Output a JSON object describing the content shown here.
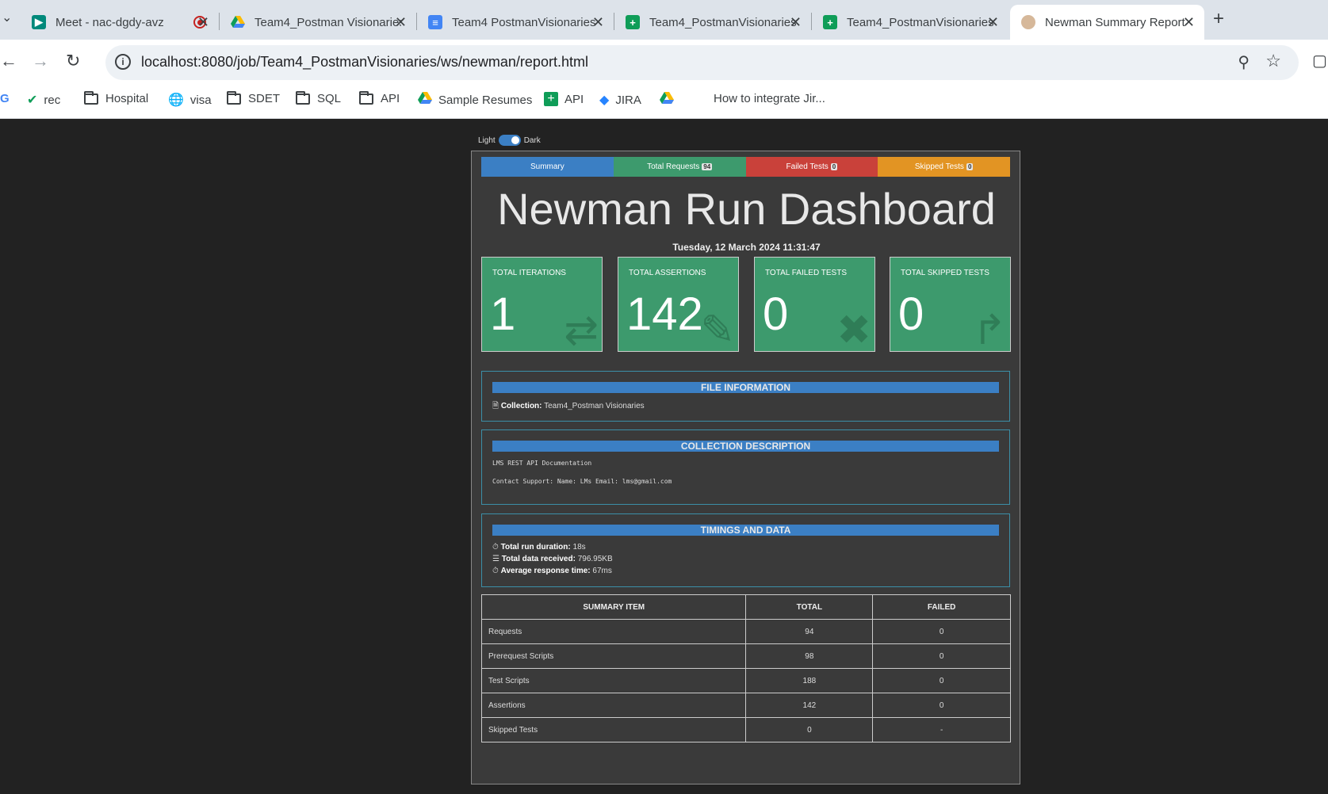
{
  "browser": {
    "tabs": [
      {
        "title": "Meet - nac-dgdy-avz",
        "icon": "google-meet-icon"
      },
      {
        "title": "Team4_Postman Visionaries",
        "icon": "google-drive-icon"
      },
      {
        "title": "Team4 PostmanVisionaries",
        "icon": "google-docs-icon"
      },
      {
        "title": "Team4_PostmanVisionaries",
        "icon": "google-sheets-icon"
      },
      {
        "title": "Team4_PostmanVisionaries",
        "icon": "google-sheets-icon"
      },
      {
        "title": "Newman Summary Report",
        "icon": "jenkins-icon"
      }
    ],
    "url": "localhost:8080/job/Team4_PostmanVisionaries/ws/newman/report.html",
    "bookmarks": [
      {
        "label": "G"
      },
      {
        "label": "rec"
      },
      {
        "label": "Hospital"
      },
      {
        "label": "visa"
      },
      {
        "label": "SDET"
      },
      {
        "label": "SQL"
      },
      {
        "label": "API"
      },
      {
        "label": "Sample Resumes"
      },
      {
        "label": "API"
      },
      {
        "label": "JIRA"
      },
      {
        "label": "How to integrate Jir..."
      }
    ]
  },
  "theme": {
    "light": "Light",
    "dark": "Dark"
  },
  "nav": {
    "summary": "Summary",
    "total_requests": "Total Requests",
    "total_requests_count": "94",
    "failed_tests": "Failed Tests",
    "failed_tests_count": "0",
    "skipped_tests": "Skipped Tests",
    "skipped_tests_count": "0"
  },
  "dashboard": {
    "title": "Newman Run Dashboard",
    "date": "Tuesday, 12 March 2024 11:31:47"
  },
  "cards": [
    {
      "label": "TOTAL ITERATIONS",
      "value": "1"
    },
    {
      "label": "TOTAL ASSERTIONS",
      "value": "142"
    },
    {
      "label": "TOTAL FAILED TESTS",
      "value": "0"
    },
    {
      "label": "TOTAL SKIPPED TESTS",
      "value": "0"
    }
  ],
  "file_info": {
    "heading": "FILE INFORMATION",
    "collection_label": "Collection:",
    "collection_value": "Team4_Postman Visionaries"
  },
  "collection_description": {
    "heading": "COLLECTION DESCRIPTION",
    "line1": "LMS REST API Documentation",
    "line2": "Contact Support: Name: LMs Email: lms@gmail.com"
  },
  "timings": {
    "heading": "TIMINGS AND DATA",
    "duration_label": "Total run duration:",
    "duration_value": "18s",
    "data_label": "Total data received:",
    "data_value": "796.95KB",
    "avg_label": "Average response time:",
    "avg_value": "67ms"
  },
  "summary_table": {
    "headers": [
      "SUMMARY ITEM",
      "TOTAL",
      "FAILED"
    ],
    "rows": [
      [
        "Requests",
        "94",
        "0"
      ],
      [
        "Prerequest Scripts",
        "98",
        "0"
      ],
      [
        "Test Scripts",
        "188",
        "0"
      ],
      [
        "Assertions",
        "142",
        "0"
      ],
      [
        "Skipped Tests",
        "0",
        "-"
      ]
    ]
  },
  "colors": {
    "summary_tab": "#3b7fc4",
    "requests_tab": "#3d9a6d",
    "failed_tab": "#c9413a",
    "skipped_tab": "#e29423",
    "card_bg": "#3d9a6d"
  }
}
